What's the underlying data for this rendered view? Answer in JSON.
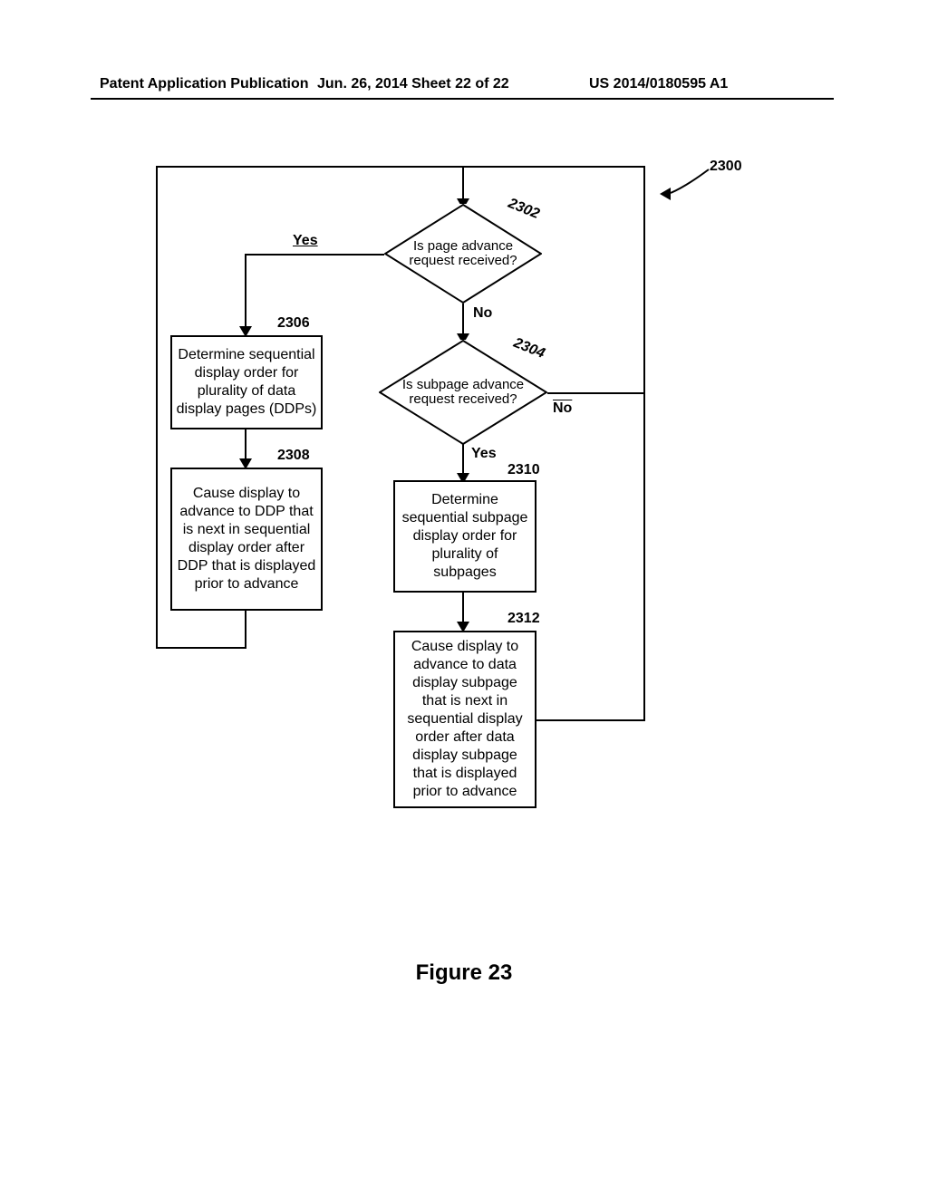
{
  "header": {
    "left": "Patent Application Publication",
    "center": "Jun. 26, 2014  Sheet 22 of 22",
    "right": "US 2014/0180595 A1"
  },
  "figure_label": "Figure 23",
  "diagram": {
    "pointer_ref": "2300",
    "d2302": {
      "ref": "2302",
      "text": "Is page advance request received?",
      "yes": "Yes",
      "no": "No"
    },
    "d2304": {
      "ref": "2304",
      "text": "Is subpage advance request received?",
      "yes": "Yes",
      "no": "No"
    },
    "b2306": {
      "ref": "2306",
      "text": "Determine sequential display order for plurality of data display pages (DDPs)"
    },
    "b2308": {
      "ref": "2308",
      "text": "Cause display to advance to DDP that is next in sequential display order after DDP that is displayed prior to advance"
    },
    "b2310": {
      "ref": "2310",
      "text": "Determine sequential subpage display order for plurality of subpages"
    },
    "b2312": {
      "ref": "2312",
      "text": "Cause display to advance to data display subpage that is next in sequential display order after data display subpage that is displayed prior to advance"
    }
  }
}
